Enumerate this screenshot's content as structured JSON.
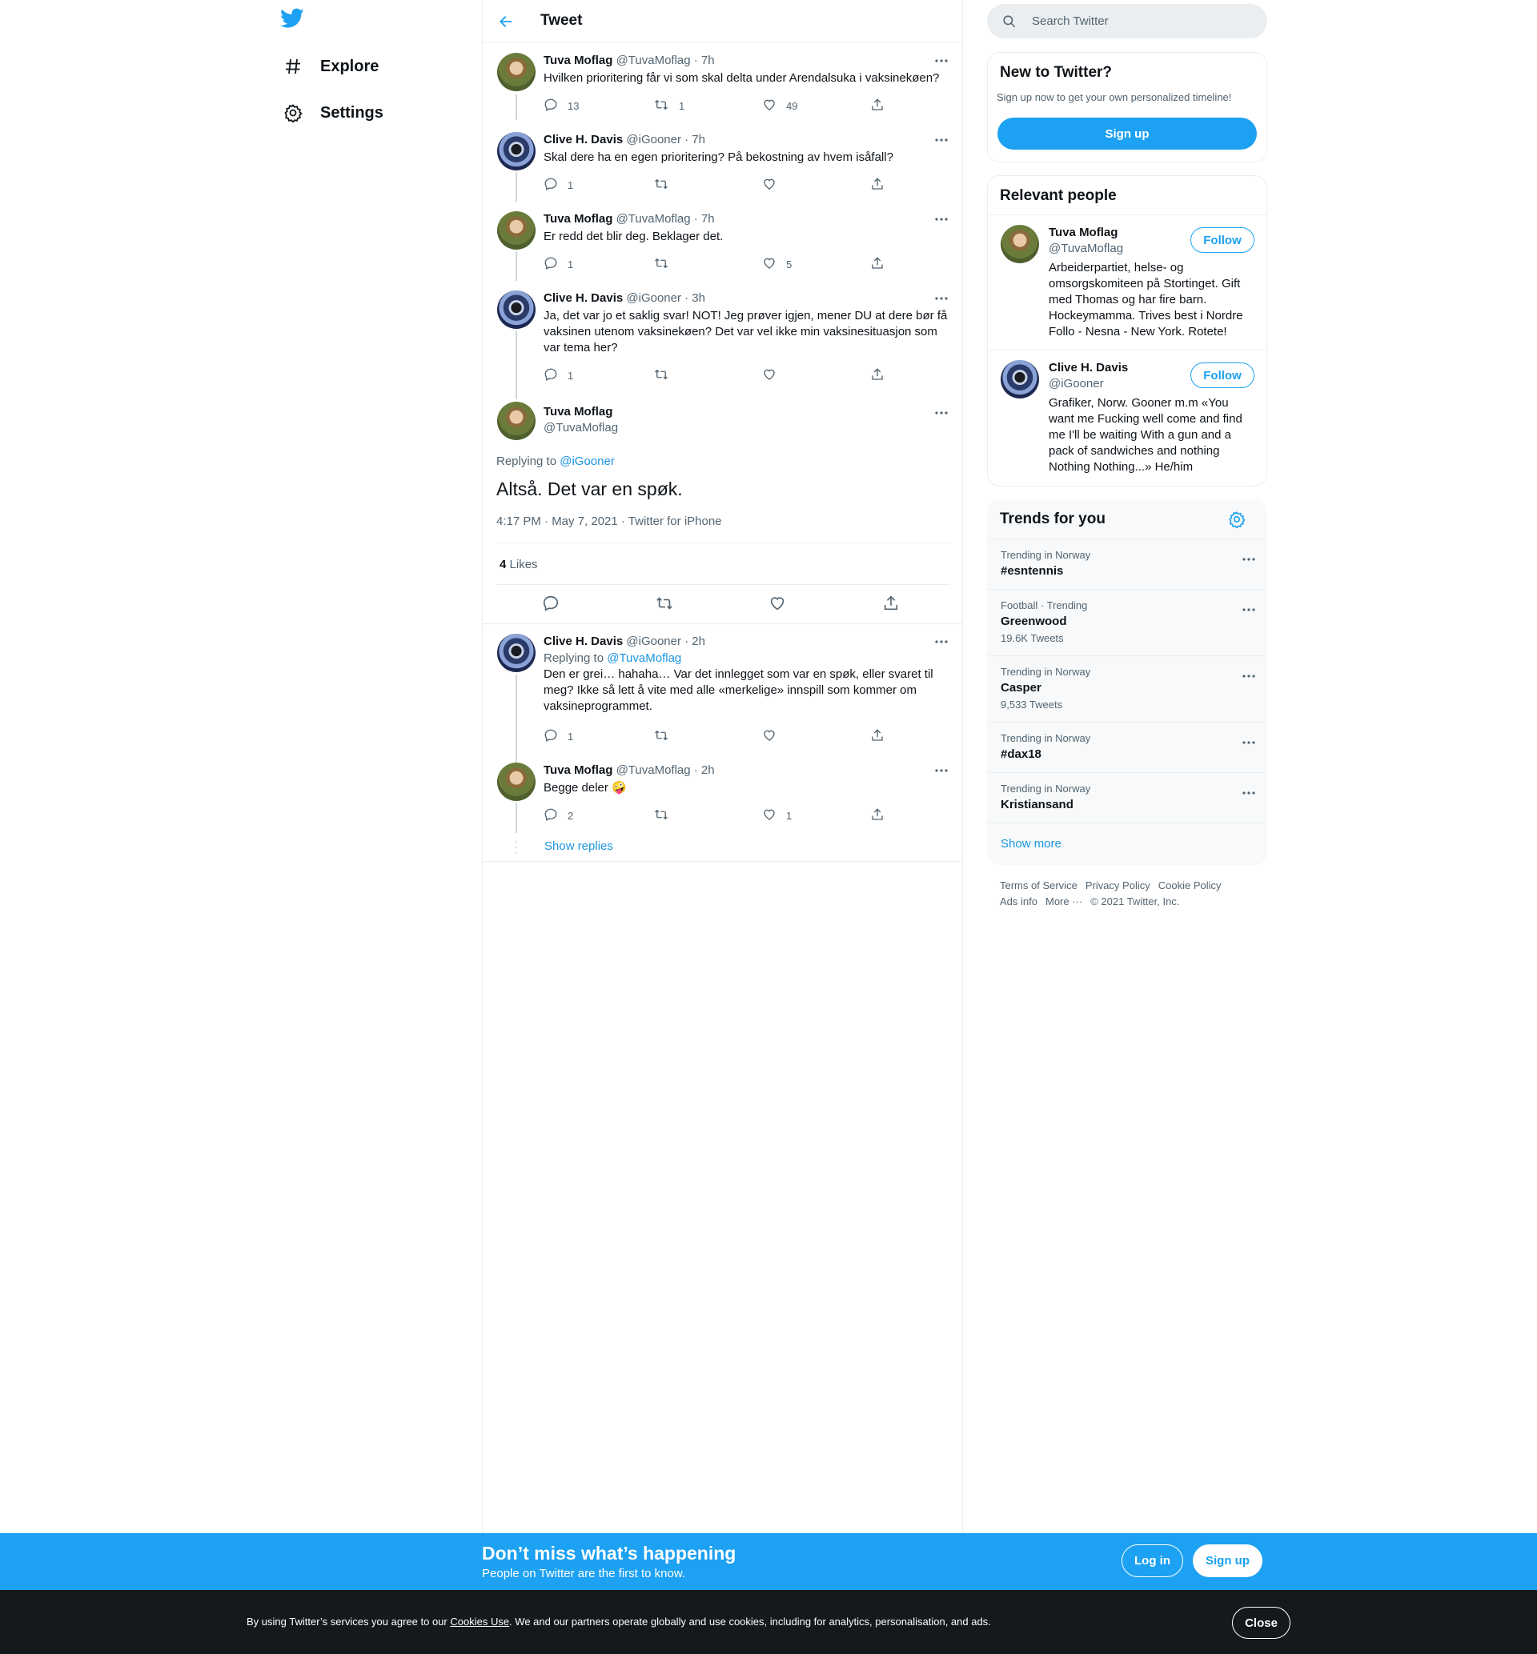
{
  "nav": {
    "explore": "Explore",
    "settings": "Settings"
  },
  "header": {
    "title": "Tweet"
  },
  "thread": [
    {
      "name": "Tuva Moflag",
      "handle": "@TuvaMoflag · 7h",
      "text": "Hvilken prioritering får vi som skal delta under Arendalsuka i vaksinekøen?",
      "replies": "13",
      "retweets": "1",
      "likes": "49"
    },
    {
      "name": "Clive H. Davis",
      "handle": "@iGooner · 7h",
      "text": "Skal dere ha en egen prioritering? På bekostning av hvem isåfall?",
      "replies": "1",
      "retweets": "",
      "likes": ""
    },
    {
      "name": "Tuva Moflag",
      "handle": "@TuvaMoflag · 7h",
      "text": "Er redd det blir deg. Beklager det.",
      "replies": "1",
      "retweets": "",
      "likes": "5"
    },
    {
      "name": "Clive H. Davis",
      "handle": "@iGooner · 3h",
      "text": "Ja, det var jo et saklig svar! NOT! Jeg prøver igjen, mener DU at dere bør få vaksinen utenom vaksinekøen? Det var vel ikke min vaksinesituasjon som var tema her?",
      "replies": "1",
      "retweets": "",
      "likes": ""
    }
  ],
  "main": {
    "name": "Tuva Moflag",
    "handle": "@TuvaMoflag",
    "replying_prefix": "Replying to",
    "replying_to": "@iGooner",
    "text": "Altså. Det var en spøk.",
    "timestamp": "4:17 PM · May 7, 2021 · Twitter for iPhone",
    "likes_count": "4",
    "likes_label": "Likes"
  },
  "replies": [
    {
      "name": "Clive H. Davis",
      "handle": "@iGooner · 2h",
      "replying_prefix": "Replying to",
      "replying_to": "@TuvaMoflag",
      "text": "Den er grei… hahaha… Var det innlegget som var en spøk, eller svaret til meg? Ikke så lett å vite med alle «merkelige» innspill som kommer om vaksineprogrammet.",
      "replies": "1",
      "retweets": "",
      "likes": ""
    },
    {
      "name": "Tuva Moflag",
      "handle": "@TuvaMoflag · 2h",
      "text": "Begge deler",
      "emoji": "🤪",
      "replies": "2",
      "retweets": "",
      "likes": "1"
    }
  ],
  "show_replies": "Show replies",
  "search": {
    "placeholder": "Search Twitter"
  },
  "new_to_twitter": {
    "title": "New to Twitter?",
    "subtitle": "Sign up now to get your own personalized timeline!",
    "button": "Sign up"
  },
  "relevant": {
    "title": "Relevant people",
    "people": [
      {
        "name": "Tuva Moflag",
        "handle": "@TuvaMoflag",
        "bio": "Arbeiderpartiet, helse- og omsorgskomiteen på Stortinget. Gift med Thomas og har fire barn. Hockeymamma. Trives best i Nordre Follo - Nesna - New York. Rotete!",
        "follow": "Follow"
      },
      {
        "name": "Clive H. Davis",
        "handle": "@iGooner",
        "bio": "Grafiker, Norw. Gooner m.m «You want me Fucking well come and find me I'll be waiting With a gun and a pack of sandwiches and nothing Nothing Nothing...» He/him",
        "follow": "Follow"
      }
    ]
  },
  "trends": {
    "title": "Trends for you",
    "items": [
      {
        "context": "Trending in Norway",
        "name": "#esntennis",
        "count": ""
      },
      {
        "context": "Football · Trending",
        "name": "Greenwood",
        "count": "19.6K Tweets"
      },
      {
        "context": "Trending in Norway",
        "name": "Casper",
        "count": "9,533 Tweets"
      },
      {
        "context": "Trending in Norway",
        "name": "#dax18",
        "count": ""
      },
      {
        "context": "Trending in Norway",
        "name": "Kristiansand",
        "count": ""
      }
    ],
    "show_more": "Show more"
  },
  "footer": {
    "terms": "Terms of Service",
    "privacy": "Privacy Policy",
    "cookie": "Cookie Policy",
    "ads": "Ads info",
    "more": "More ···",
    "copyright": "© 2021 Twitter, Inc."
  },
  "banner": {
    "title": "Don’t miss what’s happening",
    "subtitle": "People on Twitter are the first to know.",
    "login": "Log in",
    "signup": "Sign up"
  },
  "cookie": {
    "before": "By using Twitter’s services you agree to our ",
    "link": "Cookies Use",
    "after": ". We and our partners operate globally and use cookies, including for analytics, personalisation, and ads.",
    "close": "Close"
  },
  "colors": {
    "accent": "#1da1f2",
    "link": "#1b95e0",
    "muted": "#536471"
  }
}
